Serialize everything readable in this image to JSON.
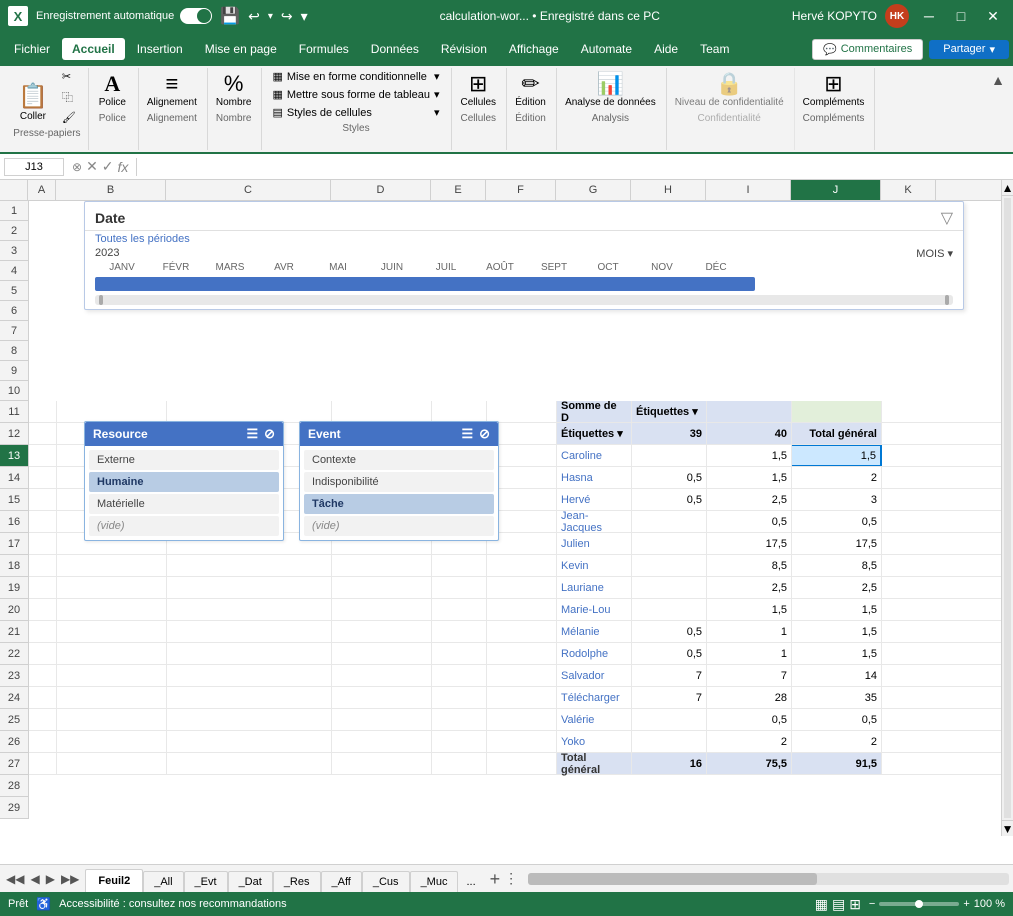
{
  "titlebar": {
    "app_icon": "X",
    "autosave_label": "Enregistrement automatique",
    "filename": "calculation-wor... • Enregistré dans ce PC",
    "user_name": "Hervé KOPYTO",
    "user_initials": "HK",
    "save_icon": "💾",
    "undo_icon": "↩",
    "redo_icon": "↪",
    "minimize_icon": "─",
    "restore_icon": "□",
    "close_icon": "✕"
  },
  "menubar": {
    "items": [
      {
        "label": "Fichier",
        "active": false
      },
      {
        "label": "Accueil",
        "active": true
      },
      {
        "label": "Insertion",
        "active": false
      },
      {
        "label": "Mise en page",
        "active": false
      },
      {
        "label": "Formules",
        "active": false
      },
      {
        "label": "Données",
        "active": false
      },
      {
        "label": "Révision",
        "active": false
      },
      {
        "label": "Affichage",
        "active": false
      },
      {
        "label": "Automate",
        "active": false
      },
      {
        "label": "Aide",
        "active": false
      },
      {
        "label": "Team",
        "active": false
      }
    ],
    "comments_label": "Commentaires",
    "share_label": "Partager"
  },
  "ribbon": {
    "presse_papiers_label": "Presse-papiers",
    "coller_label": "Coller",
    "police_label": "Police",
    "alignement_label": "Alignement",
    "nombre_label": "Nombre",
    "styles_label": "Styles",
    "cellules_label": "Cellules",
    "edition_label": "Édition",
    "analysis_label": "Analysis",
    "analyse_label": "Analyse de données",
    "confidentialite_label": "Niveau de confidentialité",
    "complements_label": "Compléments",
    "complements_group_label": "Compléments",
    "mise_en_forme_cond": "Mise en forme conditionnelle",
    "mettre_tableau": "Mettre sous forme de tableau",
    "styles_cellules": "Styles de cellules"
  },
  "formula_bar": {
    "cell_ref": "J13",
    "formula": ""
  },
  "col_headers": [
    "",
    "A",
    "B",
    "C",
    "D",
    "E",
    "F",
    "G",
    "H",
    "I",
    "J",
    "K"
  ],
  "timeline": {
    "title": "Date",
    "year": "2023",
    "period_label": "MOIS ▾",
    "months": [
      "JANV",
      "FÉVR",
      "MARS",
      "AVR",
      "MAI",
      "JUIN",
      "JUIL",
      "AOÛT",
      "SEPT",
      "OCT",
      "NOV",
      "DÉC"
    ],
    "all_periods": "Toutes les périodes"
  },
  "slicer_resource": {
    "title": "Resource",
    "items": [
      {
        "label": "Externe",
        "selected": false
      },
      {
        "label": "Humaine",
        "selected": true
      },
      {
        "label": "Matérielle",
        "selected": false
      },
      {
        "label": "(vide)",
        "selected": false
      }
    ]
  },
  "slicer_event": {
    "title": "Event",
    "items": [
      {
        "label": "Contexte",
        "selected": false
      },
      {
        "label": "Indisponibilité",
        "selected": false
      },
      {
        "label": "Tâche",
        "selected": true
      },
      {
        "label": "(vide)",
        "selected": false
      }
    ]
  },
  "pivot": {
    "header_row": [
      "Somme de D",
      "Étiquettes de colonnes ▾",
      "",
      ""
    ],
    "subheader": [
      "Étiquettes de lignes ▾",
      "39",
      "40",
      "Total général"
    ],
    "rows": [
      {
        "name": "Caroline",
        "c39": "",
        "c40": "1,5",
        "total": "1,5"
      },
      {
        "name": "Hasna",
        "c39": "0,5",
        "c40": "1,5",
        "total": "2"
      },
      {
        "name": "Hervé",
        "c39": "0,5",
        "c40": "2,5",
        "total": "3"
      },
      {
        "name": "Jean-Jacques",
        "c39": "",
        "c40": "0,5",
        "total": "0,5"
      },
      {
        "name": "Julien",
        "c39": "",
        "c40": "17,5",
        "total": "17,5"
      },
      {
        "name": "Kevin",
        "c39": "",
        "c40": "8,5",
        "total": "8,5"
      },
      {
        "name": "Lauriane",
        "c39": "",
        "c40": "2,5",
        "total": "2,5"
      },
      {
        "name": "Marie-Lou",
        "c39": "",
        "c40": "1,5",
        "total": "1,5"
      },
      {
        "name": "Mélanie",
        "c39": "0,5",
        "c40": "1",
        "total": "1,5"
      },
      {
        "name": "Rodolphe",
        "c39": "0,5",
        "c40": "1",
        "total": "1,5"
      },
      {
        "name": "Salvador",
        "c39": "7",
        "c40": "7",
        "total": "14"
      },
      {
        "name": "Télécharger",
        "c39": "7",
        "c40": "28",
        "total": "35"
      },
      {
        "name": "Valérie",
        "c39": "",
        "c40": "0,5",
        "total": "0,5"
      },
      {
        "name": "Yoko",
        "c39": "",
        "c40": "2",
        "total": "2"
      },
      {
        "name": "Total général",
        "c39": "16",
        "c40": "75,5",
        "total": "91,5"
      }
    ]
  },
  "sheet_tabs": [
    {
      "label": "Feuil2",
      "active": true
    },
    {
      "label": "_All",
      "active": false
    },
    {
      "label": "_Evt",
      "active": false
    },
    {
      "label": "_Dat",
      "active": false
    },
    {
      "label": "_Res",
      "active": false
    },
    {
      "label": "_Aff",
      "active": false
    },
    {
      "label": "_Cus",
      "active": false
    },
    {
      "label": "_Muc",
      "active": false
    },
    {
      "label": "...",
      "active": false
    }
  ],
  "statusbar": {
    "ready_label": "Prêt",
    "accessibility_label": "Accessibilité : consultez nos recommandations",
    "zoom_label": "100 %",
    "view_normal": "▦",
    "view_layout": "▤",
    "view_page": "⊞"
  }
}
